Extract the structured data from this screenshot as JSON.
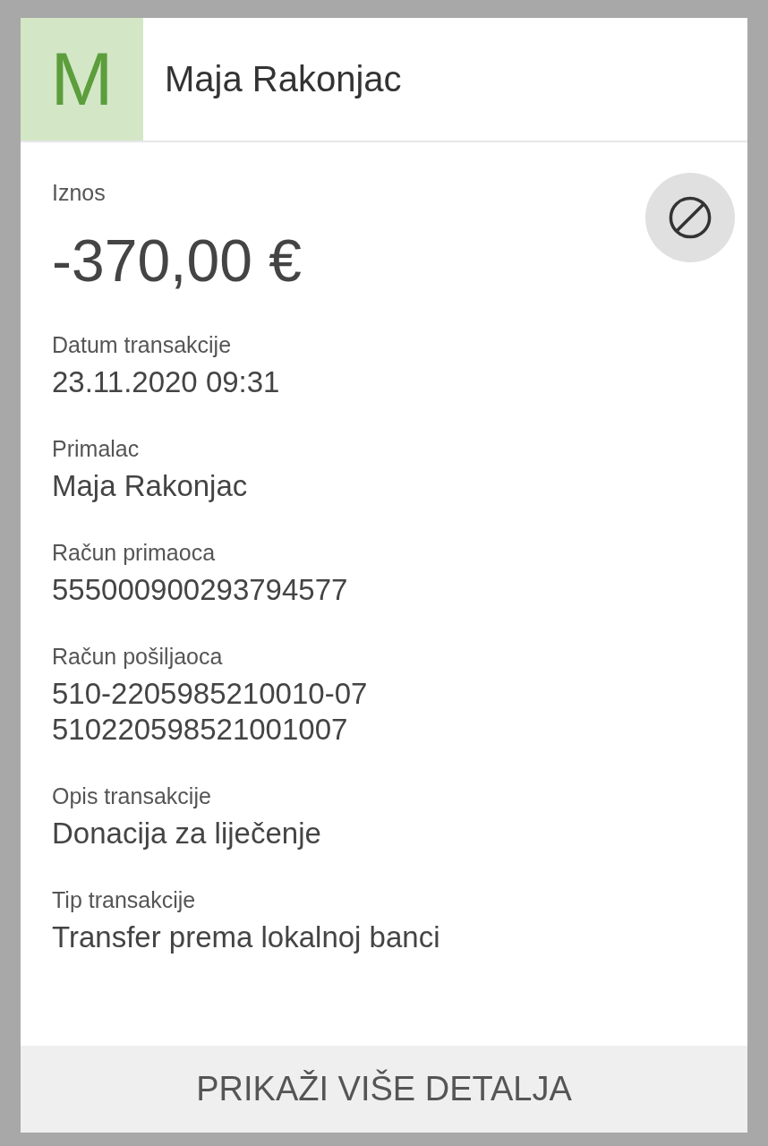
{
  "header": {
    "avatar_letter": "M",
    "name": "Maja Rakonjac"
  },
  "amount": {
    "label": "Iznos",
    "value": "-370,00 €"
  },
  "fields": [
    {
      "label": "Datum transakcije",
      "lines": [
        "23.11.2020 09:31"
      ]
    },
    {
      "label": "Primalac",
      "lines": [
        "Maja Rakonjac"
      ]
    },
    {
      "label": "Račun primaoca",
      "lines": [
        "555000900293794577"
      ]
    },
    {
      "label": "Račun pošiljaoca",
      "lines": [
        "510-2205985210010-07",
        "510220598521001007"
      ]
    },
    {
      "label": "Opis transakcije",
      "lines": [
        "Donacija za liječenje"
      ]
    },
    {
      "label": "Tip transakcije",
      "lines": [
        "Transfer prema lokalnoj banci"
      ]
    }
  ],
  "footer_button": "PRIKAŽI VIŠE DETALJA"
}
